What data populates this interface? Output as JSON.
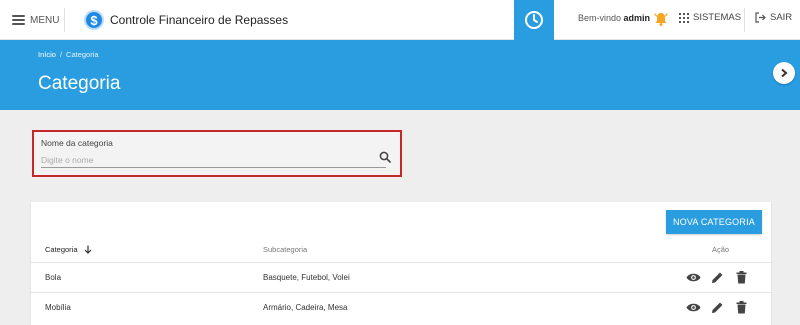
{
  "topbar": {
    "menu_label": "MENU",
    "app_title": "Controle Financeiro de Repasses",
    "logo_glyph": "$",
    "welcome_prefix": "Bem-vindo",
    "username": "admin",
    "systems_label": "SISTEMAS",
    "logout_label": "SAIR"
  },
  "breadcrumb": {
    "home": "Início",
    "separator": "/",
    "current": "Categoria"
  },
  "page": {
    "title": "Categoria"
  },
  "search": {
    "label": "Nome da categoria",
    "placeholder": "Digite o nome",
    "value": ""
  },
  "table": {
    "new_button_label": "NOVA CATEGORIA",
    "headers": {
      "category": "Categoria",
      "subcategory": "Subcategoria",
      "action": "Ação"
    },
    "sort_icon": "arrow-down-icon",
    "rows": [
      {
        "category": "Bola",
        "subcategory": "Basquete, Futebol, Volei"
      },
      {
        "category": "Mobília",
        "subcategory": "Armário, Cadeira, Mesa"
      }
    ]
  },
  "colors": {
    "primary": "#2a9de0",
    "highlight_border": "#c62828",
    "bell": "#f5a623",
    "background": "#eeeeee"
  }
}
